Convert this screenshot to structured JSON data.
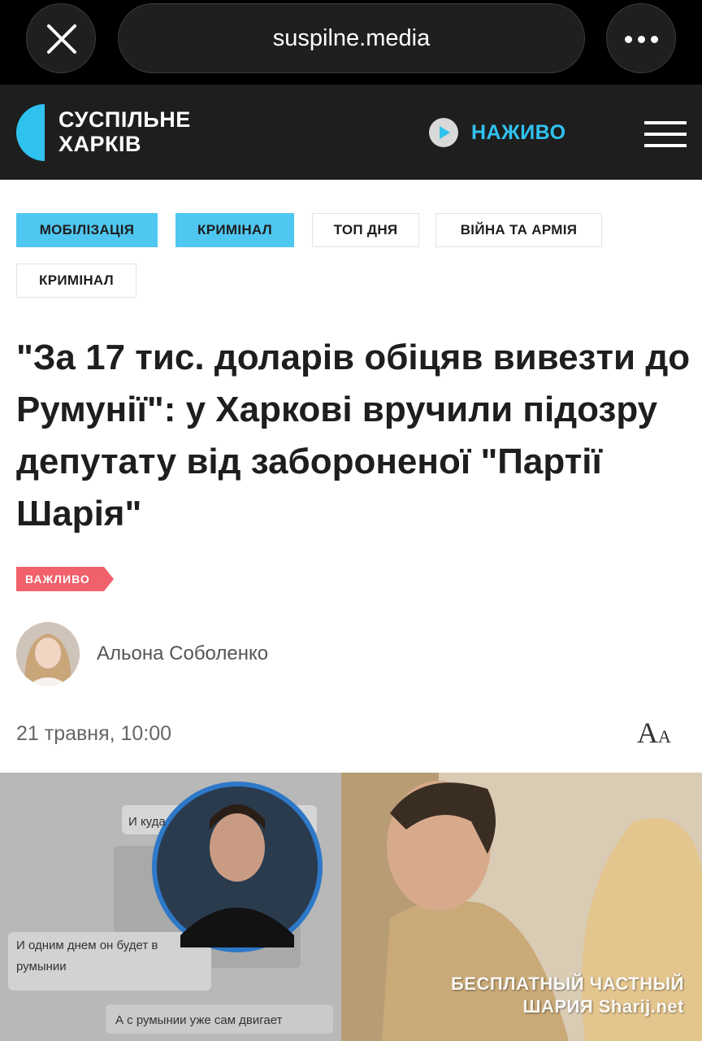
{
  "browser": {
    "url": "suspilne.media"
  },
  "header": {
    "logo_line1": "СУСПІЛЬНЕ",
    "logo_line2": "ХАРКІВ",
    "live_label": "НАЖИВО"
  },
  "tags": [
    {
      "label": "МОБІЛІЗАЦІЯ",
      "highlighted": true
    },
    {
      "label": "КРИМІНАЛ",
      "highlighted": true
    },
    {
      "label": "ТОП ДНЯ",
      "highlighted": false
    },
    {
      "label": "ВІЙНА ТА АРМІЯ",
      "highlighted": false
    },
    {
      "label": "КРИМІНАЛ",
      "highlighted": false
    }
  ],
  "article": {
    "headline": "\"За 17 тис. доларів обіцяв вивезти до Румунії\": у Харкові вручили підозру депутату від забороненої \"Партії Шарія\"",
    "badge": "ВАЖЛИВО",
    "author": "Альона Соболенко",
    "date": "21 травня, 10:00",
    "font_size_label": "A",
    "font_size_small": "A"
  },
  "photo": {
    "chat_lines": [
      "И куда",
      "И одним днем он будет в",
      "румынии",
      "А с румынии уже сам двигает"
    ],
    "watermark_line1": "БЕСПЛАТНЫЙ ЧАСТНЫЙ",
    "watermark_line2": "ШАРИЯ Sharij.net"
  },
  "colors": {
    "accent": "#30c2ef",
    "tag_blue": "#4fc7f0",
    "badge_red": "#f0616b",
    "header_bg": "#1e1e1e"
  }
}
